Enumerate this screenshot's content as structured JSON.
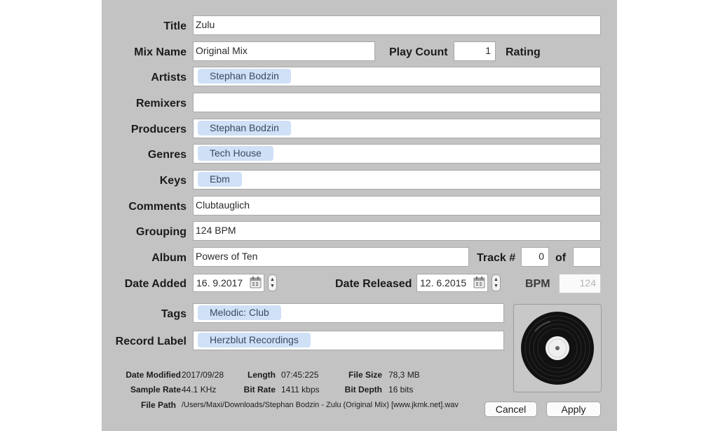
{
  "labels": {
    "title": "Title",
    "mix_name": "Mix Name",
    "play_count": "Play Count",
    "rating": "Rating",
    "artists": "Artists",
    "remixers": "Remixers",
    "producers": "Producers",
    "genres": "Genres",
    "keys": "Keys",
    "comments": "Comments",
    "grouping": "Grouping",
    "album": "Album",
    "track_no": "Track #",
    "of": "of",
    "date_added": "Date Added",
    "date_released": "Date Released",
    "bpm": "BPM",
    "tags": "Tags",
    "record_label": "Record Label"
  },
  "fields": {
    "title": "Zulu",
    "mix_name": "Original Mix",
    "play_count": "1",
    "artists": [
      "Stephan Bodzin"
    ],
    "remixers": [],
    "producers": [
      "Stephan Bodzin"
    ],
    "genres": [
      "Tech House"
    ],
    "keys": [
      "Ebm"
    ],
    "comments": "Clubtauglich",
    "grouping": "124 BPM",
    "album": "Powers of Ten",
    "track_no": "0",
    "track_of": "",
    "date_added": "16.  9.2017",
    "date_released": "12.  6.2015",
    "bpm": "124",
    "tags": [
      "Melodic: Club"
    ],
    "record_label": [
      "Herzblut Recordings"
    ]
  },
  "info": {
    "date_modified_label": "Date Modified",
    "date_modified": "2017/09/28",
    "length_label": "Length",
    "length": "07:45:225",
    "file_size_label": "File Size",
    "file_size": "78,3 MB",
    "sample_rate_label": "Sample Rate",
    "sample_rate": "44.1 KHz",
    "bit_rate_label": "Bit Rate",
    "bit_rate": "1411 kbps",
    "bit_depth_label": "Bit Depth",
    "bit_depth": "16 bits",
    "file_path_label": "File Path",
    "file_path": "/Users/Maxi/Downloads/Stephan Bodzin - Zulu (Original Mix) [www.jkmk.net].wav"
  },
  "buttons": {
    "cancel": "Cancel",
    "apply": "Apply"
  },
  "icons": {
    "calendar": "calendar-icon",
    "stepper": "stepper-icon",
    "artwork": "vinyl-record-icon"
  },
  "colors": {
    "dialog_bg": "#c3c3c3",
    "token_bg": "#cfe0f7",
    "token_text": "#3b4a5e"
  }
}
